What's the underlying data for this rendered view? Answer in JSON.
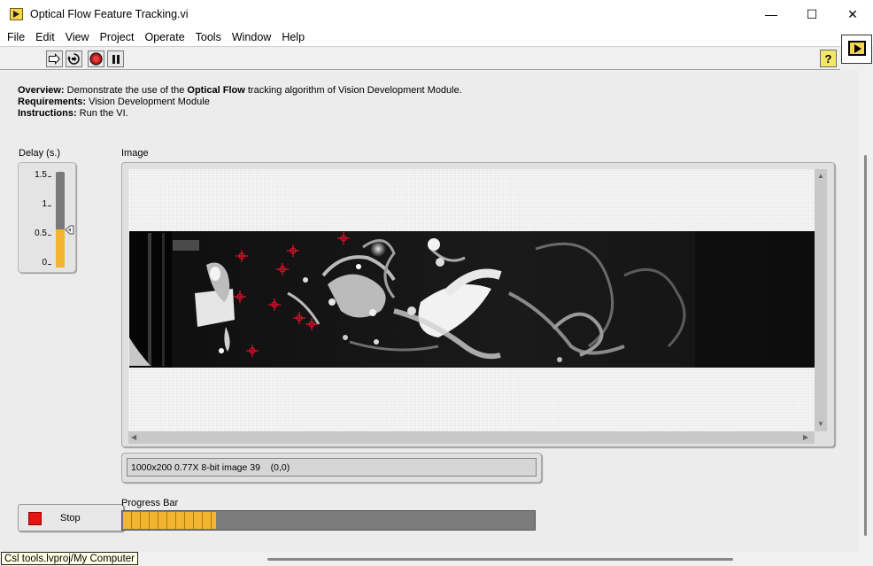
{
  "window": {
    "title": "Optical Flow Feature Tracking.vi",
    "minimize_glyph": "—",
    "maximize_glyph": "☐",
    "close_glyph": "✕"
  },
  "menu": [
    "File",
    "Edit",
    "View",
    "Project",
    "Operate",
    "Tools",
    "Window",
    "Help"
  ],
  "toolbar": {
    "run_icon": "run-arrow-icon",
    "run_continuous_icon": "run-continuously-icon",
    "abort_icon": "abort-execution-icon",
    "pause_icon": "pause-icon",
    "help_label": "?"
  },
  "description": {
    "overview_label": "Overview:",
    "overview_pre": " Demonstrate the use of the ",
    "overview_bold": "Optical Flow",
    "overview_post": " tracking algorithm of Vision Development Module.",
    "requirements_label": "Requirements:",
    "requirements_text": " Vision Development Module",
    "instructions_label": "Instructions:",
    "instructions_text": " Run the VI."
  },
  "delay": {
    "label": "Delay (s.)",
    "ticks": [
      "1.5",
      "1",
      "0.5",
      "0"
    ],
    "min": 0,
    "max": 1.5,
    "value": 0.6,
    "fill_color": "#f3b531"
  },
  "image": {
    "label": "Image",
    "info": "1000x200 0.77X 8-bit image 39    (0,0)",
    "marker_color": "#e0102a"
  },
  "stop": {
    "label": "Stop",
    "color": "#e21414"
  },
  "progress": {
    "label": "Progress Bar",
    "fraction": 0.225,
    "color": "#f3b531"
  },
  "status": {
    "context": "Csl tools.lvproj/My Computer"
  }
}
